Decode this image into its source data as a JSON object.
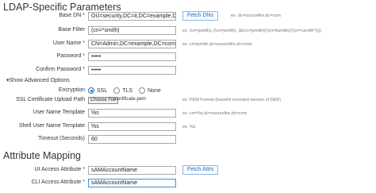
{
  "ldap": {
    "heading": "LDAP-Specific Parameters",
    "base_dn": {
      "label": "Base DN",
      "value": "OU=security,DC=it,DC=example,DC",
      "hint": "ex. dc=sourcefire,dc=com"
    },
    "fetch_dns": "Fetch DNs",
    "base_filter": {
      "label": "Base Filter",
      "value": "(cn=*smith)",
      "hint": "ex. (cn=jsmith), (!cn=jsmith), (&(cn=jsmith)(!(cn=bsmith)(!(cn=csmith*))))"
    },
    "user_name": {
      "label": "User Name",
      "value": "CN=Admin,DC=example,DC=com",
      "hint": "ex. cn=jsmith,dc=sourcefire,dc=com"
    },
    "password": {
      "label": "Password",
      "value": "•••••"
    },
    "confirm_password": {
      "label": "Confirm Password",
      "value": "•••••"
    },
    "advanced_toggle": "▾Show Advanced Options",
    "encryption": {
      "label": "Encryption",
      "options": [
        "SSL",
        "TLS",
        "None"
      ],
      "selected": "SSL"
    },
    "ssl_cert": {
      "label": "SSL Certificate Upload Path",
      "button": "Choose File",
      "file": "certificate.pem",
      "hint": "ex. PEM Format (base64 encoded version of DER)"
    },
    "user_name_template": {
      "label": "User Name Template",
      "value": "%s",
      "hint": "ex. cn=%s,dc=sourcefire,dc=com"
    },
    "shell_user_name_template": {
      "label": "Shell User Name Template",
      "value": "%s",
      "hint": "ex. %s"
    },
    "timeout": {
      "label": "Timeout (Seconds)",
      "value": "60"
    }
  },
  "attr": {
    "heading": "Attribute Mapping",
    "ui_access": {
      "label": "UI Access Attribute",
      "value": "sAMAccountName"
    },
    "fetch_attrs": "Fetch Attrs",
    "cli_access": {
      "label": "CLI Access Attribute",
      "value": "sAMAccountName"
    }
  },
  "colors": {
    "accent": "#1a73c9",
    "required": "#d0021b",
    "focus_border": "#3f8fd8"
  }
}
